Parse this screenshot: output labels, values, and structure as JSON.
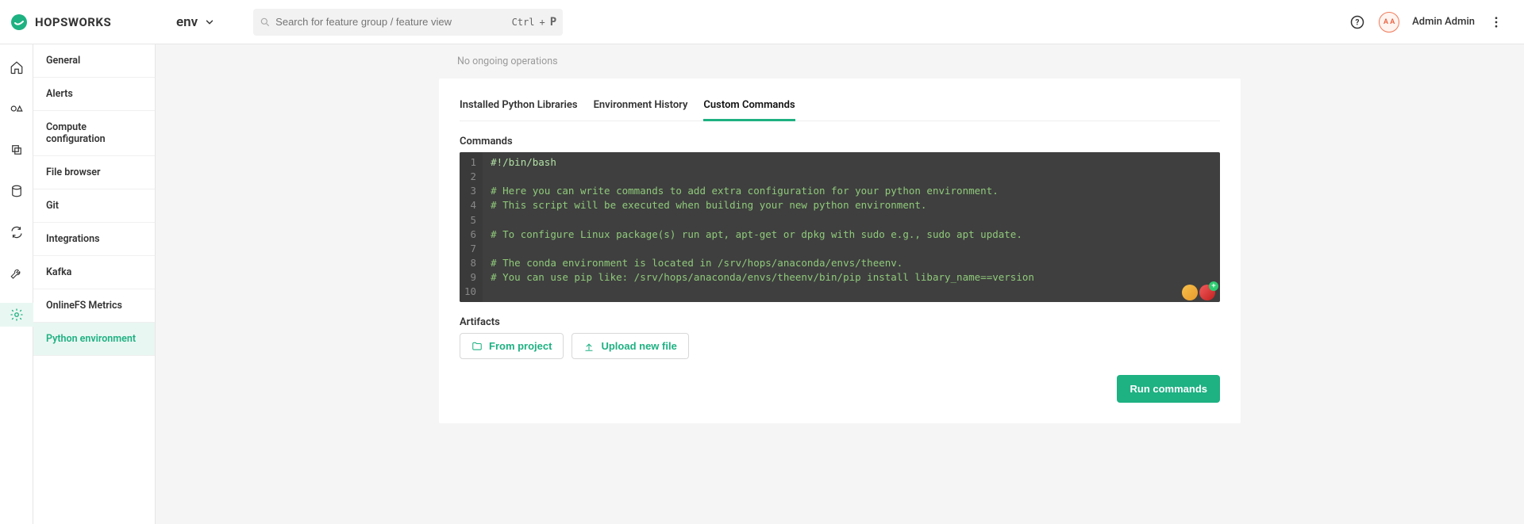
{
  "header": {
    "brand": "HOPSWORKS",
    "project": "env",
    "search_placeholder": "Search for feature group / feature view",
    "kbd_ctrl": "Ctrl",
    "kbd_plus": "+",
    "kbd_p": "P",
    "user_initials": "A A",
    "user_name": "Admin Admin"
  },
  "sidebar": {
    "items": [
      {
        "label": "General"
      },
      {
        "label": "Alerts"
      },
      {
        "label": "Compute configuration"
      },
      {
        "label": "File browser"
      },
      {
        "label": "Git"
      },
      {
        "label": "Integrations"
      },
      {
        "label": "Kafka"
      },
      {
        "label": "OnlineFS Metrics"
      },
      {
        "label": "Python environment"
      }
    ]
  },
  "status": "No ongoing operations",
  "tabs": [
    {
      "label": "Installed Python Libraries"
    },
    {
      "label": "Environment History"
    },
    {
      "label": "Custom Commands"
    }
  ],
  "sections": {
    "commands_label": "Commands",
    "artifacts_label": "Artifacts"
  },
  "editor": {
    "lines": [
      "#!/bin/bash",
      "",
      "# Here you can write commands to add extra configuration for your python environment.",
      "# This script will be executed when building your new python environment.",
      "",
      "# To configure Linux package(s) run apt, apt-get or dpkg with sudo e.g., sudo apt update.",
      "",
      "# The conda environment is located in /srv/hops/anaconda/envs/theenv.",
      "# You can use pip like: /srv/hops/anaconda/envs/theenv/bin/pip install libary_name==version",
      ""
    ]
  },
  "buttons": {
    "from_project": "From project",
    "upload": "Upload new file",
    "run": "Run commands"
  }
}
